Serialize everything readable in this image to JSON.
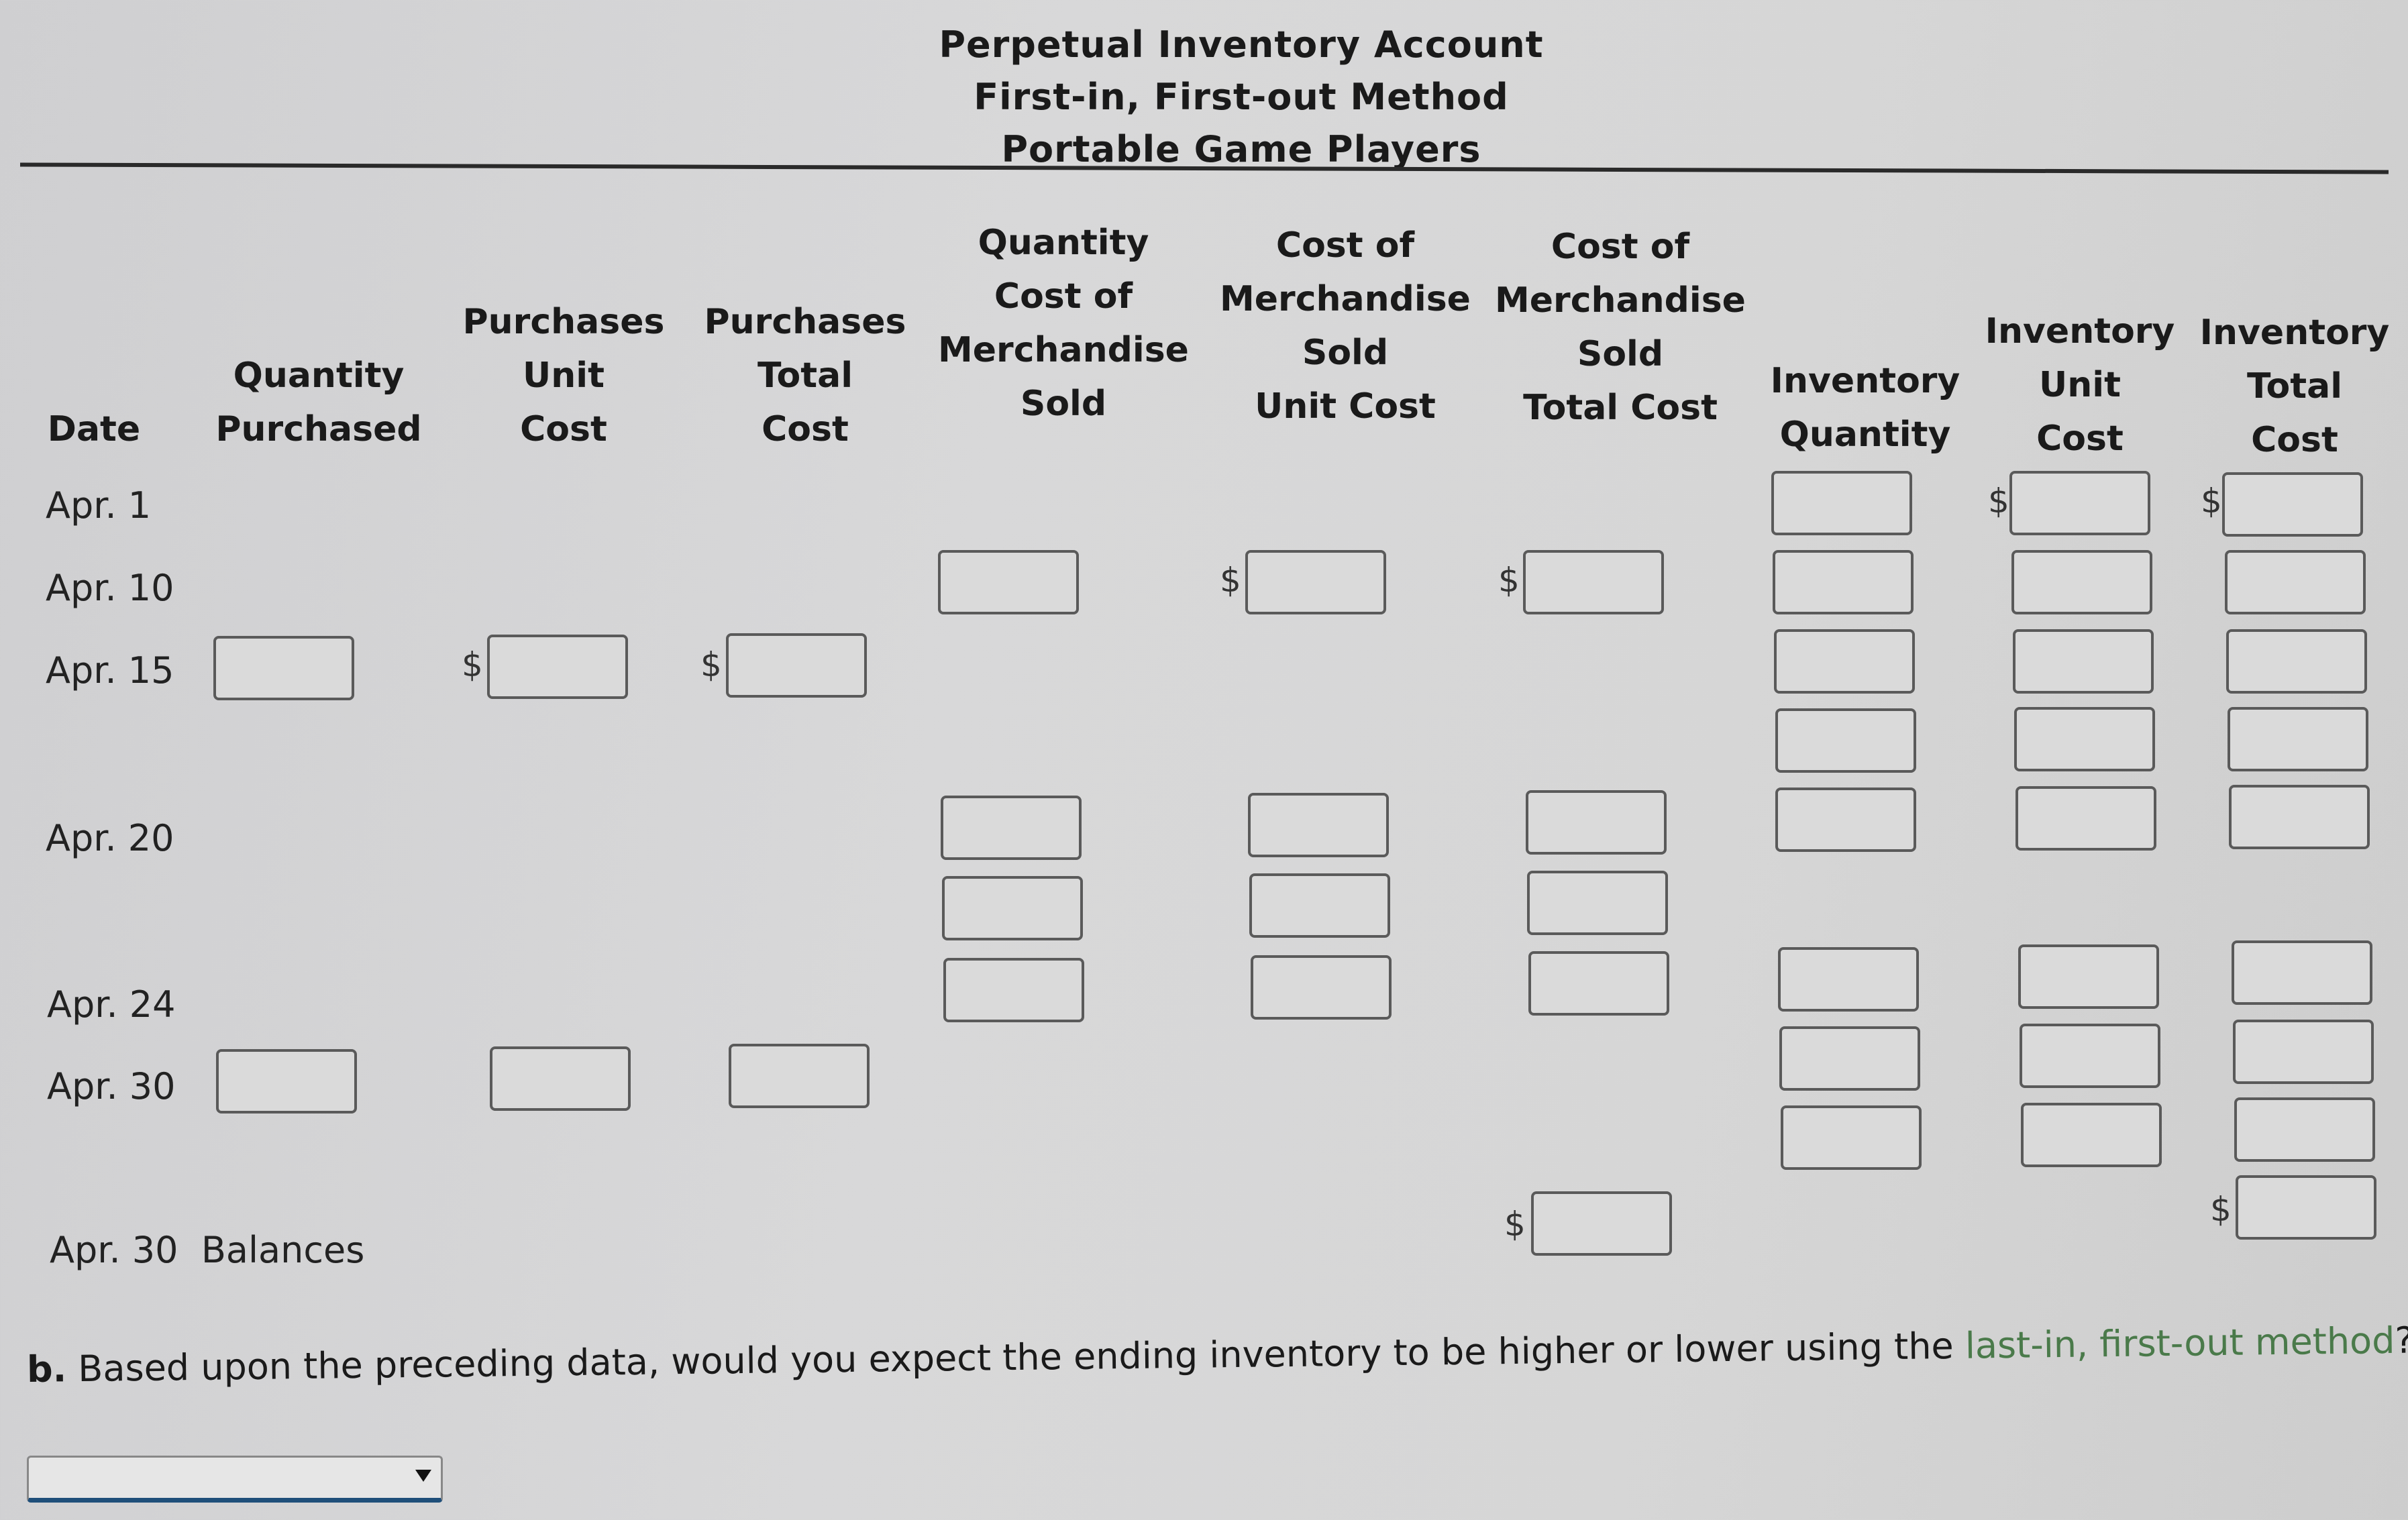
{
  "title": {
    "line1": "Perpetual Inventory Account",
    "line2": "First-in, First-out Method",
    "line3": "Portable Game Players"
  },
  "columns": {
    "date": [
      "Date"
    ],
    "quantity_purchased": [
      "Quantity",
      "Purchased"
    ],
    "purchases_unit_cost": [
      "Purchases",
      "Unit",
      "Cost"
    ],
    "purchases_total_cost": [
      "Purchases",
      "Total",
      "Cost"
    ],
    "quantity_cogs": [
      "Quantity",
      "Cost of",
      "Merchandise",
      "Sold"
    ],
    "cogs_unit_cost": [
      "Cost of",
      "Merchandise",
      "Sold",
      "Unit Cost"
    ],
    "cogs_total_cost": [
      "Cost of",
      "Merchandise",
      "Sold",
      "Total Cost"
    ],
    "inventory_quantity": [
      "Inventory",
      "Quantity"
    ],
    "inventory_unit_cost": [
      "Inventory",
      "Unit",
      "Cost"
    ],
    "inventory_total_cost": [
      "Inventory",
      "Total",
      "Cost"
    ]
  },
  "rows": [
    {
      "date": "Apr. 1"
    },
    {
      "date": "Apr. 10"
    },
    {
      "date": "Apr. 15"
    },
    {
      "date": "Apr. 20"
    },
    {
      "date": "Apr. 24"
    },
    {
      "date": "Apr. 30"
    },
    {
      "date": "Apr. 30",
      "label": "Balances"
    }
  ],
  "currency_symbol": "$",
  "question": {
    "prefix": "b.",
    "text": " Based upon the preceding data, would you expect the ending inventory to be higher or lower using the ",
    "link": "last-in, first-out method",
    "suffix": "?"
  },
  "answer_select": {
    "selected": "",
    "icon": "chevron-down-icon"
  }
}
